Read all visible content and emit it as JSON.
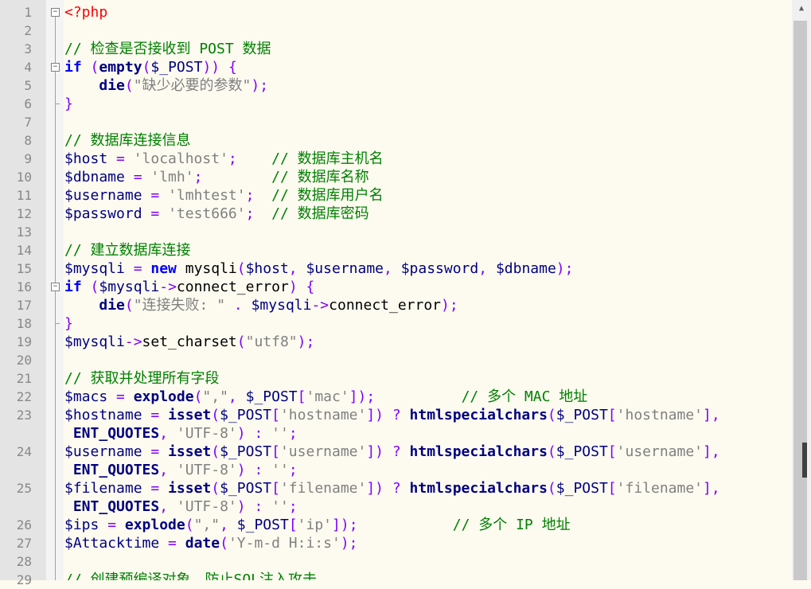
{
  "lines": [
    {
      "num": "1",
      "tokens": [
        {
          "t": "<?php",
          "c": "tag"
        }
      ]
    },
    {
      "num": "2",
      "tokens": []
    },
    {
      "num": "3",
      "tokens": [
        {
          "t": "// 检查是否接收到 POST 数据",
          "c": "cmt"
        }
      ]
    },
    {
      "num": "4",
      "tokens": [
        {
          "t": "if",
          "c": "kw"
        },
        {
          "t": " ",
          "c": "plain"
        },
        {
          "t": "(",
          "c": "op"
        },
        {
          "t": "empty",
          "c": "fn"
        },
        {
          "t": "(",
          "c": "op"
        },
        {
          "t": "$_POST",
          "c": "var"
        },
        {
          "t": ")) {",
          "c": "op"
        }
      ]
    },
    {
      "num": "5",
      "tokens": [
        {
          "t": "    ",
          "c": "plain"
        },
        {
          "t": "die",
          "c": "fn"
        },
        {
          "t": "(",
          "c": "op"
        },
        {
          "t": "\"缺少必要的参数\"",
          "c": "str"
        },
        {
          "t": ");",
          "c": "op"
        }
      ]
    },
    {
      "num": "6",
      "tokens": [
        {
          "t": "}",
          "c": "op"
        }
      ]
    },
    {
      "num": "7",
      "tokens": []
    },
    {
      "num": "8",
      "tokens": [
        {
          "t": "// 数据库连接信息",
          "c": "cmt"
        }
      ]
    },
    {
      "num": "9",
      "tokens": [
        {
          "t": "$host",
          "c": "var"
        },
        {
          "t": " = ",
          "c": "op"
        },
        {
          "t": "'localhost'",
          "c": "str"
        },
        {
          "t": ";",
          "c": "op"
        },
        {
          "t": "    ",
          "c": "plain"
        },
        {
          "t": "// 数据库主机名",
          "c": "cmt"
        }
      ]
    },
    {
      "num": "10",
      "tokens": [
        {
          "t": "$dbname",
          "c": "var"
        },
        {
          "t": " = ",
          "c": "op"
        },
        {
          "t": "'lmh'",
          "c": "str"
        },
        {
          "t": ";",
          "c": "op"
        },
        {
          "t": "        ",
          "c": "plain"
        },
        {
          "t": "// 数据库名称",
          "c": "cmt"
        }
      ]
    },
    {
      "num": "11",
      "tokens": [
        {
          "t": "$username",
          "c": "var"
        },
        {
          "t": " = ",
          "c": "op"
        },
        {
          "t": "'lmhtest'",
          "c": "str"
        },
        {
          "t": ";",
          "c": "op"
        },
        {
          "t": "  ",
          "c": "plain"
        },
        {
          "t": "// 数据库用户名",
          "c": "cmt"
        }
      ]
    },
    {
      "num": "12",
      "tokens": [
        {
          "t": "$password",
          "c": "var"
        },
        {
          "t": " = ",
          "c": "op"
        },
        {
          "t": "'test666'",
          "c": "str"
        },
        {
          "t": ";",
          "c": "op"
        },
        {
          "t": "  ",
          "c": "plain"
        },
        {
          "t": "// 数据库密码",
          "c": "cmt"
        }
      ]
    },
    {
      "num": "13",
      "tokens": []
    },
    {
      "num": "14",
      "tokens": [
        {
          "t": "// 建立数据库连接",
          "c": "cmt"
        }
      ]
    },
    {
      "num": "15",
      "tokens": [
        {
          "t": "$mysqli",
          "c": "var"
        },
        {
          "t": " = ",
          "c": "op"
        },
        {
          "t": "new",
          "c": "kw"
        },
        {
          "t": " mysqli",
          "c": "plain"
        },
        {
          "t": "(",
          "c": "op"
        },
        {
          "t": "$host",
          "c": "var"
        },
        {
          "t": ", ",
          "c": "op"
        },
        {
          "t": "$username",
          "c": "var"
        },
        {
          "t": ", ",
          "c": "op"
        },
        {
          "t": "$password",
          "c": "var"
        },
        {
          "t": ", ",
          "c": "op"
        },
        {
          "t": "$dbname",
          "c": "var"
        },
        {
          "t": ");",
          "c": "op"
        }
      ]
    },
    {
      "num": "16",
      "tokens": [
        {
          "t": "if",
          "c": "kw"
        },
        {
          "t": " ",
          "c": "plain"
        },
        {
          "t": "(",
          "c": "op"
        },
        {
          "t": "$mysqli",
          "c": "var"
        },
        {
          "t": "->",
          "c": "op"
        },
        {
          "t": "connect_error",
          "c": "plain"
        },
        {
          "t": ") {",
          "c": "op"
        }
      ]
    },
    {
      "num": "17",
      "tokens": [
        {
          "t": "    ",
          "c": "plain"
        },
        {
          "t": "die",
          "c": "fn"
        },
        {
          "t": "(",
          "c": "op"
        },
        {
          "t": "\"连接失败: \"",
          "c": "str"
        },
        {
          "t": " . ",
          "c": "op"
        },
        {
          "t": "$mysqli",
          "c": "var"
        },
        {
          "t": "->",
          "c": "op"
        },
        {
          "t": "connect_error",
          "c": "plain"
        },
        {
          "t": ");",
          "c": "op"
        }
      ]
    },
    {
      "num": "18",
      "tokens": [
        {
          "t": "}",
          "c": "op"
        }
      ]
    },
    {
      "num": "19",
      "tokens": [
        {
          "t": "$mysqli",
          "c": "var"
        },
        {
          "t": "->",
          "c": "op"
        },
        {
          "t": "set_charset",
          "c": "plain"
        },
        {
          "t": "(",
          "c": "op"
        },
        {
          "t": "\"utf8\"",
          "c": "str"
        },
        {
          "t": ");",
          "c": "op"
        }
      ]
    },
    {
      "num": "20",
      "tokens": []
    },
    {
      "num": "21",
      "tokens": [
        {
          "t": "// 获取并处理所有字段",
          "c": "cmt"
        }
      ]
    },
    {
      "num": "22",
      "tokens": [
        {
          "t": "$macs",
          "c": "var"
        },
        {
          "t": " = ",
          "c": "op"
        },
        {
          "t": "explode",
          "c": "fn"
        },
        {
          "t": "(",
          "c": "op"
        },
        {
          "t": "\",\"",
          "c": "str"
        },
        {
          "t": ", ",
          "c": "op"
        },
        {
          "t": "$_POST",
          "c": "var"
        },
        {
          "t": "[",
          "c": "op"
        },
        {
          "t": "'mac'",
          "c": "str"
        },
        {
          "t": "]);",
          "c": "op"
        },
        {
          "t": "          ",
          "c": "plain"
        },
        {
          "t": "// 多个 MAC 地址",
          "c": "cmt"
        }
      ]
    },
    {
      "num": "23",
      "tokens": [
        {
          "t": "$hostname",
          "c": "var"
        },
        {
          "t": " = ",
          "c": "op"
        },
        {
          "t": "isset",
          "c": "fn"
        },
        {
          "t": "(",
          "c": "op"
        },
        {
          "t": "$_POST",
          "c": "var"
        },
        {
          "t": "[",
          "c": "op"
        },
        {
          "t": "'hostname'",
          "c": "str"
        },
        {
          "t": "]) ? ",
          "c": "op"
        },
        {
          "t": "htmlspecialchars",
          "c": "fn"
        },
        {
          "t": "(",
          "c": "op"
        },
        {
          "t": "$_POST",
          "c": "var"
        },
        {
          "t": "[",
          "c": "op"
        },
        {
          "t": "'hostname'",
          "c": "str"
        },
        {
          "t": "],",
          "c": "op"
        }
      ]
    },
    {
      "num": "",
      "tokens": [
        {
          "t": " ",
          "c": "plain"
        },
        {
          "t": "ENT_QUOTES",
          "c": "fn"
        },
        {
          "t": ", ",
          "c": "op"
        },
        {
          "t": "'UTF-8'",
          "c": "str"
        },
        {
          "t": ") : ",
          "c": "op"
        },
        {
          "t": "''",
          "c": "str"
        },
        {
          "t": ";",
          "c": "op"
        }
      ]
    },
    {
      "num": "24",
      "tokens": [
        {
          "t": "$username",
          "c": "var"
        },
        {
          "t": " = ",
          "c": "op"
        },
        {
          "t": "isset",
          "c": "fn"
        },
        {
          "t": "(",
          "c": "op"
        },
        {
          "t": "$_POST",
          "c": "var"
        },
        {
          "t": "[",
          "c": "op"
        },
        {
          "t": "'username'",
          "c": "str"
        },
        {
          "t": "]) ? ",
          "c": "op"
        },
        {
          "t": "htmlspecialchars",
          "c": "fn"
        },
        {
          "t": "(",
          "c": "op"
        },
        {
          "t": "$_POST",
          "c": "var"
        },
        {
          "t": "[",
          "c": "op"
        },
        {
          "t": "'username'",
          "c": "str"
        },
        {
          "t": "],",
          "c": "op"
        }
      ]
    },
    {
      "num": "",
      "tokens": [
        {
          "t": " ",
          "c": "plain"
        },
        {
          "t": "ENT_QUOTES",
          "c": "fn"
        },
        {
          "t": ", ",
          "c": "op"
        },
        {
          "t": "'UTF-8'",
          "c": "str"
        },
        {
          "t": ") : ",
          "c": "op"
        },
        {
          "t": "''",
          "c": "str"
        },
        {
          "t": ";",
          "c": "op"
        }
      ]
    },
    {
      "num": "25",
      "tokens": [
        {
          "t": "$filename",
          "c": "var"
        },
        {
          "t": " = ",
          "c": "op"
        },
        {
          "t": "isset",
          "c": "fn"
        },
        {
          "t": "(",
          "c": "op"
        },
        {
          "t": "$_POST",
          "c": "var"
        },
        {
          "t": "[",
          "c": "op"
        },
        {
          "t": "'filename'",
          "c": "str"
        },
        {
          "t": "]) ? ",
          "c": "op"
        },
        {
          "t": "htmlspecialchars",
          "c": "fn"
        },
        {
          "t": "(",
          "c": "op"
        },
        {
          "t": "$_POST",
          "c": "var"
        },
        {
          "t": "[",
          "c": "op"
        },
        {
          "t": "'filename'",
          "c": "str"
        },
        {
          "t": "],",
          "c": "op"
        }
      ]
    },
    {
      "num": "",
      "tokens": [
        {
          "t": " ",
          "c": "plain"
        },
        {
          "t": "ENT_QUOTES",
          "c": "fn"
        },
        {
          "t": ", ",
          "c": "op"
        },
        {
          "t": "'UTF-8'",
          "c": "str"
        },
        {
          "t": ") : ",
          "c": "op"
        },
        {
          "t": "''",
          "c": "str"
        },
        {
          "t": ";",
          "c": "op"
        }
      ]
    },
    {
      "num": "26",
      "tokens": [
        {
          "t": "$ips",
          "c": "var"
        },
        {
          "t": " = ",
          "c": "op"
        },
        {
          "t": "explode",
          "c": "fn"
        },
        {
          "t": "(",
          "c": "op"
        },
        {
          "t": "\",\"",
          "c": "str"
        },
        {
          "t": ", ",
          "c": "op"
        },
        {
          "t": "$_POST",
          "c": "var"
        },
        {
          "t": "[",
          "c": "op"
        },
        {
          "t": "'ip'",
          "c": "str"
        },
        {
          "t": "]);",
          "c": "op"
        },
        {
          "t": "           ",
          "c": "plain"
        },
        {
          "t": "// 多个 IP 地址",
          "c": "cmt"
        }
      ]
    },
    {
      "num": "27",
      "tokens": [
        {
          "t": "$Attacktime",
          "c": "var"
        },
        {
          "t": " = ",
          "c": "op"
        },
        {
          "t": "date",
          "c": "fn"
        },
        {
          "t": "(",
          "c": "op"
        },
        {
          "t": "'Y-m-d H:i:s'",
          "c": "str"
        },
        {
          "t": ");",
          "c": "op"
        }
      ]
    },
    {
      "num": "28",
      "tokens": []
    },
    {
      "num": "29",
      "tokens": [
        {
          "t": "// 创建预编译对象，防止SQL注入攻击",
          "c": "cmt"
        }
      ]
    }
  ]
}
